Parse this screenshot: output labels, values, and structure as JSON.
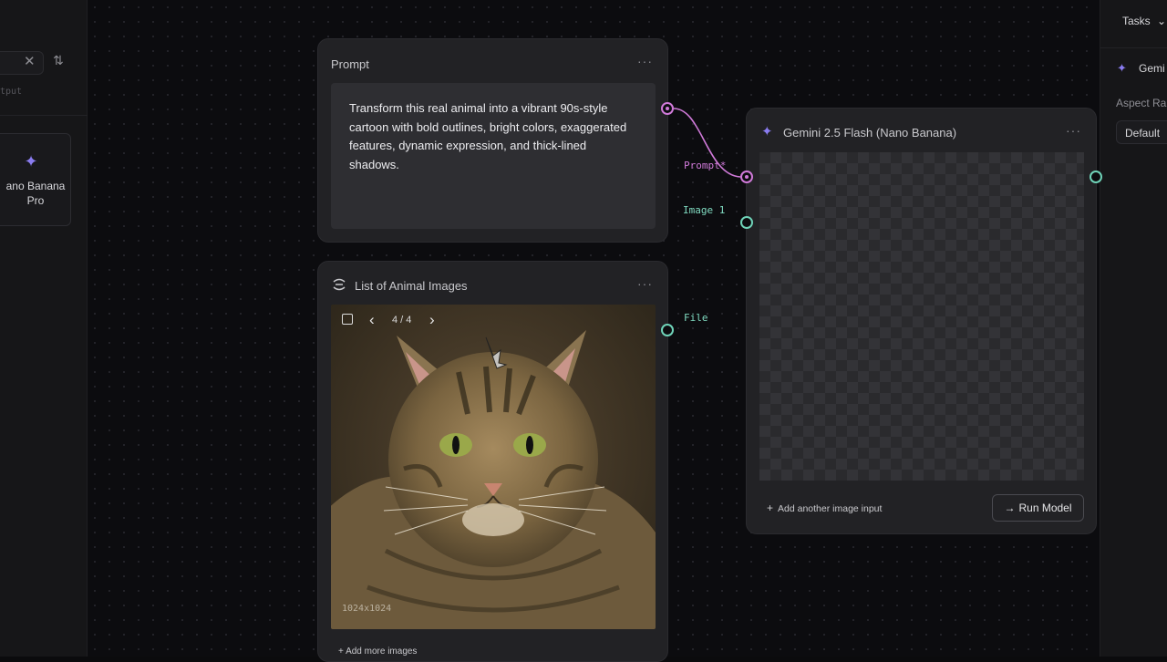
{
  "left_panel": {
    "clear_icon": "✕",
    "sort_icon": "sort-arrows-icon",
    "sort_glyph": "⇅",
    "tag": "tput",
    "model_card": {
      "label_line1": "ano Banana",
      "label_line2": "Pro",
      "icon": "sparkle-icon",
      "glyph": "✦"
    }
  },
  "right_panel": {
    "tasks_label": "Tasks",
    "chevron_glyph": "⌄",
    "model_label": "Gemi",
    "model_glyph": "✦",
    "aspect_label": "Aspect Ra",
    "aspect_value": "Default"
  },
  "prompt_node": {
    "title": "Prompt",
    "menu_glyph": "···",
    "text": "Transform this real animal into a vibrant 90s-style cartoon with bold outlines, bright colors, exaggerated features, dynamic expression, and thick-lined shadows."
  },
  "list_node": {
    "title": "List of Animal Images",
    "menu_glyph": "···",
    "icon": "list-refresh-icon",
    "pager": {
      "prev": "‹",
      "next": "›",
      "counter": "4 / 4"
    },
    "image_dims": "1024x1024",
    "add_more_label": "+ Add more images",
    "output_label": "File"
  },
  "gemini_node": {
    "title": "Gemini 2.5 Flash (Nano Banana)",
    "menu_glyph": "···",
    "title_glyph": "✦",
    "inputs": [
      {
        "label": "Prompt*"
      },
      {
        "label": "Image 1"
      }
    ],
    "add_input_label": "Add another image input",
    "add_glyph": "+",
    "run_label": "Run Model",
    "run_glyph": "→"
  },
  "colors": {
    "prompt_port": "#d07ad9",
    "image_port": "#6fd3b8",
    "accent": "#8a7cf0"
  }
}
